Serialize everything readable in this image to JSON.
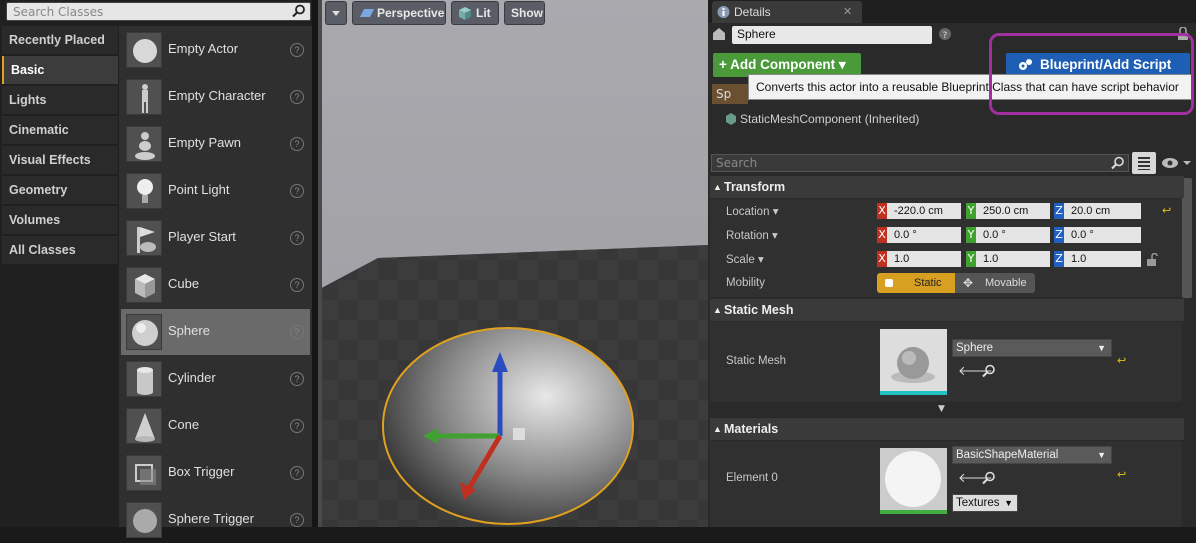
{
  "place_panel": {
    "search_placeholder": "Search Classes",
    "categories": [
      "Recently Placed",
      "Basic",
      "Lights",
      "Cinematic",
      "Visual Effects",
      "Geometry",
      "Volumes",
      "All Classes"
    ],
    "selected_category": "Basic",
    "items": [
      "Empty Actor",
      "Empty Character",
      "Empty Pawn",
      "Point Light",
      "Player Start",
      "Cube",
      "Sphere",
      "Cylinder",
      "Cone",
      "Box Trigger",
      "Sphere Trigger"
    ],
    "selected_item": "Sphere"
  },
  "viewport": {
    "perspective_label": "Perspective",
    "lit_label": "Lit",
    "show_label": "Show"
  },
  "details": {
    "tab_label": "Details",
    "actor_name": "Sphere",
    "add_component_label": "Add Component",
    "blueprint_label": "Blueprint/Add Script",
    "tooltip": "Converts this actor into a reusable Blueprint Class that can have script behavior",
    "component_truncated": "Sp",
    "static_mesh_component": "StaticMeshComponent (Inherited)",
    "search_placeholder": "Search",
    "transform": {
      "header": "Transform",
      "location_label": "Location",
      "location": [
        "-220.0 cm",
        "250.0 cm",
        "20.0 cm"
      ],
      "rotation_label": "Rotation",
      "rotation": [
        "0.0 °",
        "0.0 °",
        "0.0 °"
      ],
      "scale_label": "Scale",
      "scale": [
        "1.0",
        "1.0",
        "1.0"
      ],
      "mobility_label": "Mobility",
      "static_label": "Static",
      "movable_label": "Movable"
    },
    "static_mesh": {
      "header": "Static Mesh",
      "row_label": "Static Mesh",
      "value": "Sphere"
    },
    "materials": {
      "header": "Materials",
      "row_label": "Element 0",
      "value": "BasicShapeMaterial",
      "textures_label": "Textures"
    }
  },
  "colors": {
    "highlight": "#a030a0",
    "add_component": "#4a9a3a",
    "blueprint": "#1e5fb5",
    "selection_ring": "#e0a020"
  }
}
